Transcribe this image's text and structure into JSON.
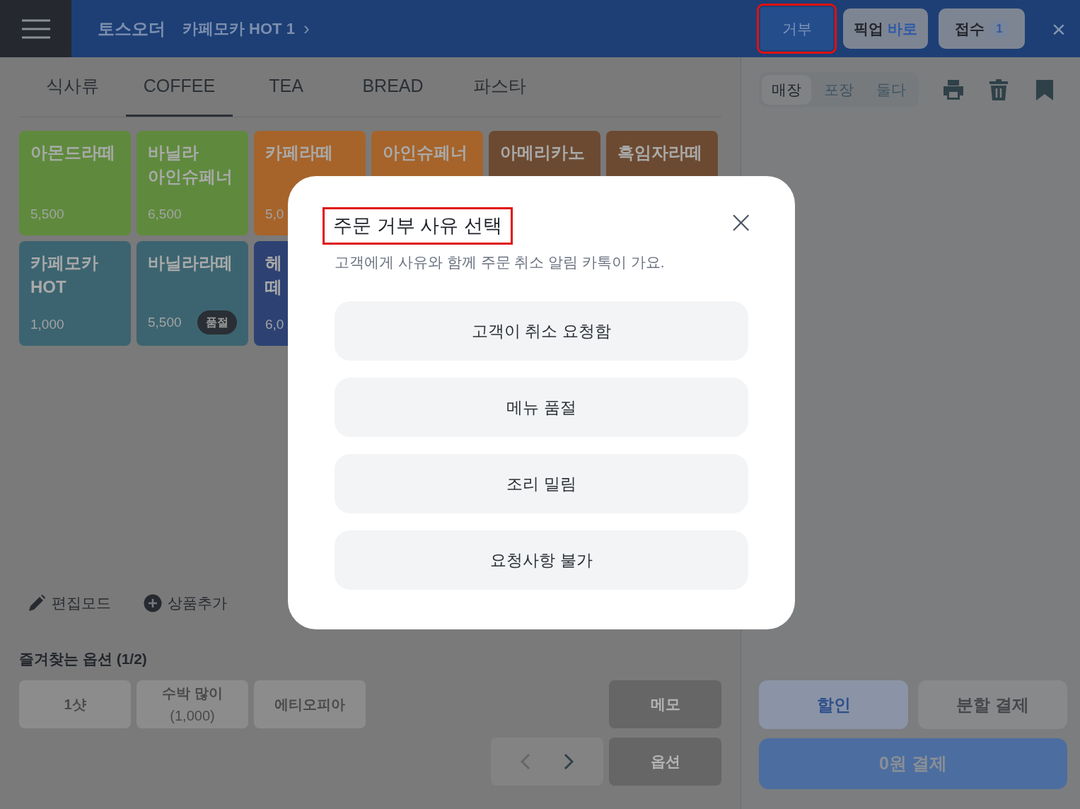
{
  "header": {
    "brand": "토스오더",
    "order_title": "카페모카 HOT 1",
    "order_chevron": "›",
    "buttons": [
      {
        "kind": "reject",
        "label": "거부",
        "highlighted": true
      },
      {
        "kind": "pickup",
        "label": "픽업",
        "accent": "바로",
        "highlighted": false
      },
      {
        "kind": "accept",
        "label": "접수",
        "count": "1",
        "highlighted": false
      }
    ],
    "close": "×"
  },
  "tabs": [
    {
      "label": "식사류",
      "selected": false
    },
    {
      "label": "COFFEE",
      "selected": true
    },
    {
      "label": "TEA",
      "selected": false
    },
    {
      "label": "BREAD",
      "selected": false
    },
    {
      "label": "파스타",
      "selected": false
    }
  ],
  "products": [
    {
      "name_lines": [
        "아몬드라떼"
      ],
      "price": "5,500",
      "color": "#5f8a3d",
      "sold_out": false
    },
    {
      "name_lines": [
        "바닐라",
        "아인슈페너"
      ],
      "price": "6,500",
      "color": "#5f8a3d",
      "sold_out": false
    },
    {
      "name_lines": [
        "카페라떼"
      ],
      "price": "5,0",
      "color": "#a6642b",
      "sold_out": false
    },
    {
      "name_lines": [
        "아인슈페너"
      ],
      "color": "#a6642b",
      "sold_out": false
    },
    {
      "name_lines": [
        "아메리카노"
      ],
      "color": "#6c4a31",
      "sold_out": false
    },
    {
      "name_lines": [
        "흑임자라떼"
      ],
      "color": "#6c4a31",
      "sold_out": false
    },
    {
      "name_lines": [
        "카페모카",
        "HOT"
      ],
      "price": "1,000",
      "color": "#3c6470",
      "sold_out": false
    },
    {
      "name_lines": [
        "바닐라라떼"
      ],
      "price": "5,500",
      "color": "#3c6470",
      "sold_out": true,
      "badge": "품절"
    },
    {
      "name_lines": [
        "헤",
        "떼"
      ],
      "price": "6,0",
      "color": "#2d4273",
      "sold_out": false
    }
  ],
  "tools": [
    {
      "kind": "edit",
      "label": "편집모드"
    },
    {
      "kind": "add",
      "label": "상품추가"
    }
  ],
  "favorite_options": {
    "title": "즐겨찾는 옵션 (1/2)",
    "options": [
      {
        "lines": [
          "1샷"
        ]
      },
      {
        "lines": [
          "수박 많이",
          "(1,000)"
        ]
      },
      {
        "lines": [
          "에티오피아"
        ]
      }
    ],
    "memo": "메모",
    "option": "옵션"
  },
  "order_panel": {
    "modes": [
      {
        "label": "매장",
        "selected": true
      },
      {
        "label": "포장",
        "selected": false
      },
      {
        "label": "둘다",
        "selected": false
      }
    ],
    "discount": "할인",
    "split_pay": "분할 결제",
    "pay": "0원 결제"
  },
  "dialog": {
    "title": "주문 거부 사유 선택",
    "title_highlighted": true,
    "subtitle": "고객에게 사유와 함께 주문 취소 알림 카톡이 가요.",
    "close": "×",
    "reasons": [
      "고객이 취소 요청함",
      "메뉴 품절",
      "조리 밀림",
      "요청사항 불가"
    ]
  }
}
